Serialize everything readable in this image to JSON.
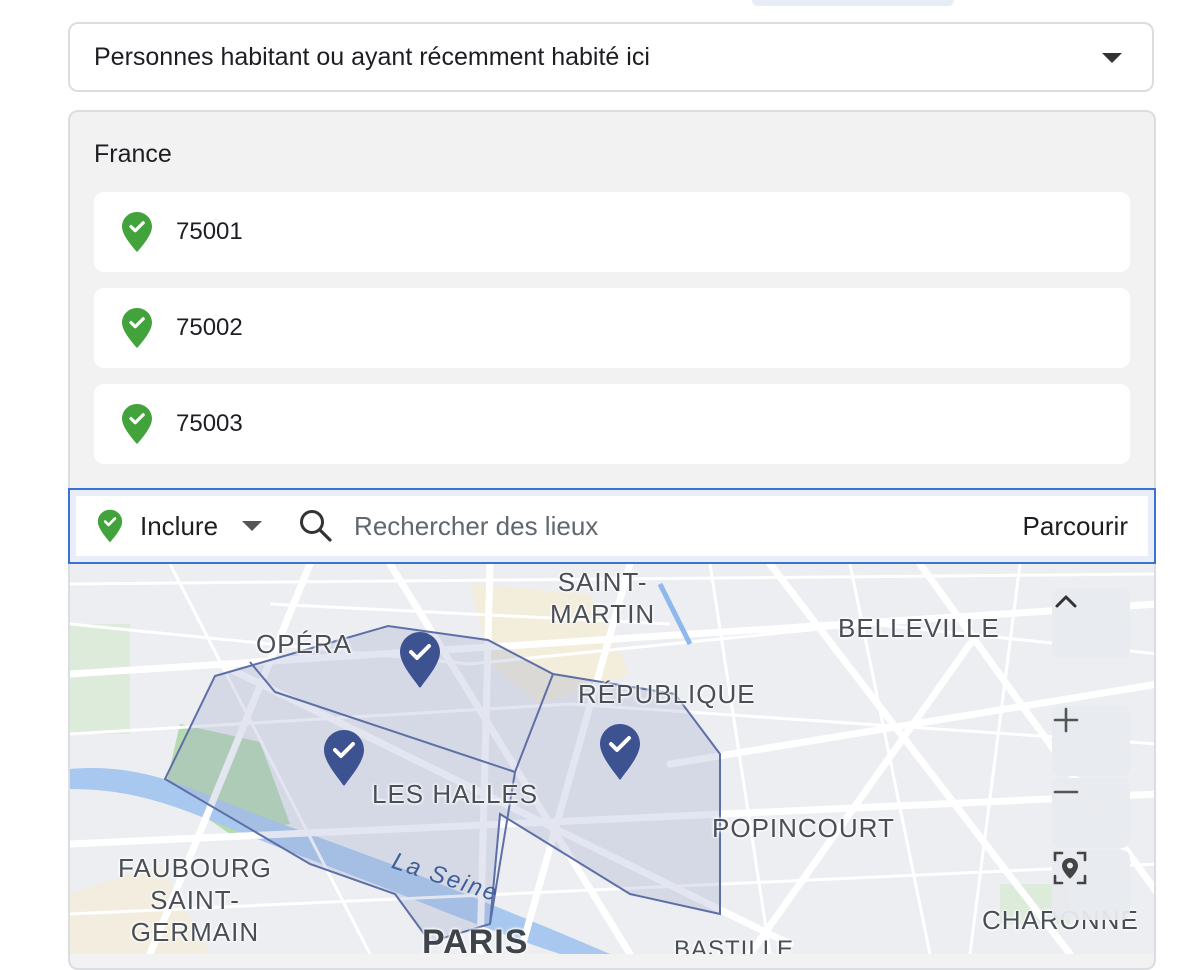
{
  "location_type_dropdown": {
    "selected": "Personnes habitant ou ayant récemment habité ici",
    "caret_icon": "caret-down-icon"
  },
  "locations": {
    "country": "France",
    "items": [
      {
        "code": "75001",
        "icon": "check-pin-icon"
      },
      {
        "code": "75002",
        "icon": "check-pin-icon"
      },
      {
        "code": "75003",
        "icon": "check-pin-icon"
      }
    ]
  },
  "search_bar": {
    "mode": "Inclure",
    "placeholder": "Rechercher des lieux",
    "browse_label": "Parcourir"
  },
  "map": {
    "labels": {
      "saint_martin": "SAINT-\nMARTIN",
      "opera": "OPÉRA",
      "belleville": "BELLEVILLE",
      "republique": "RÉPUBLIQUE",
      "les_halles": "LES HALLES",
      "popincourt": "POPINCOURT",
      "faubourg": "FAUBOURG\nSAINT-\nGERMAIN",
      "charonne": "CHARONNE",
      "paris": "PARIS",
      "bastille": "BASTILLE",
      "seine": "La Seine"
    },
    "controls": [
      "collapse",
      "zoom-in",
      "zoom-out",
      "locate"
    ]
  },
  "colors": {
    "accent_blue": "#3b73d4",
    "pin_green": "#42a33c",
    "map_pin_navy": "#3d5291"
  }
}
